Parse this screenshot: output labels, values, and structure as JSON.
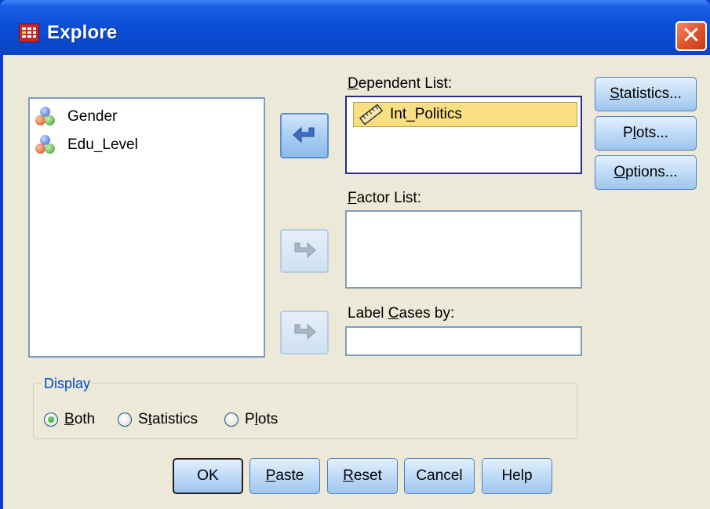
{
  "window": {
    "title": "Explore",
    "close_symbol": "✕"
  },
  "source_list": {
    "items": [
      {
        "label": "Gender",
        "icon": "nominal-variable-icon"
      },
      {
        "label": "Edu_Level",
        "icon": "nominal-variable-icon"
      }
    ]
  },
  "dependent_list": {
    "label_pre": "",
    "label_mn": "D",
    "label_post": "ependent List:",
    "items": [
      {
        "label": "Int_Politics",
        "icon": "scale-variable-icon"
      }
    ]
  },
  "factor_list": {
    "label_pre": "",
    "label_mn": "F",
    "label_post": "actor List:",
    "items": []
  },
  "label_cases": {
    "label_pre": "Label ",
    "label_mn": "C",
    "label_post": "ases by:",
    "value": ""
  },
  "side_buttons": {
    "statistics": {
      "pre": "",
      "mn": "S",
      "post": "tatistics..."
    },
    "plots": {
      "pre": "P",
      "mn": "l",
      "post": "ots..."
    },
    "options": {
      "pre": "",
      "mn": "O",
      "post": "ptions..."
    }
  },
  "display": {
    "title": "Display",
    "options": [
      {
        "pre": "",
        "mn": "B",
        "post": "oth",
        "checked": true
      },
      {
        "pre": "S",
        "mn": "t",
        "post": "atistics",
        "checked": false
      },
      {
        "pre": "P",
        "mn": "l",
        "post": "ots",
        "checked": false
      }
    ]
  },
  "bottom_buttons": {
    "ok": "OK",
    "paste": {
      "pre": "",
      "mn": "P",
      "post": "aste"
    },
    "reset": {
      "pre": "",
      "mn": "R",
      "post": "eset"
    },
    "cancel": "Cancel",
    "help": "Help"
  }
}
